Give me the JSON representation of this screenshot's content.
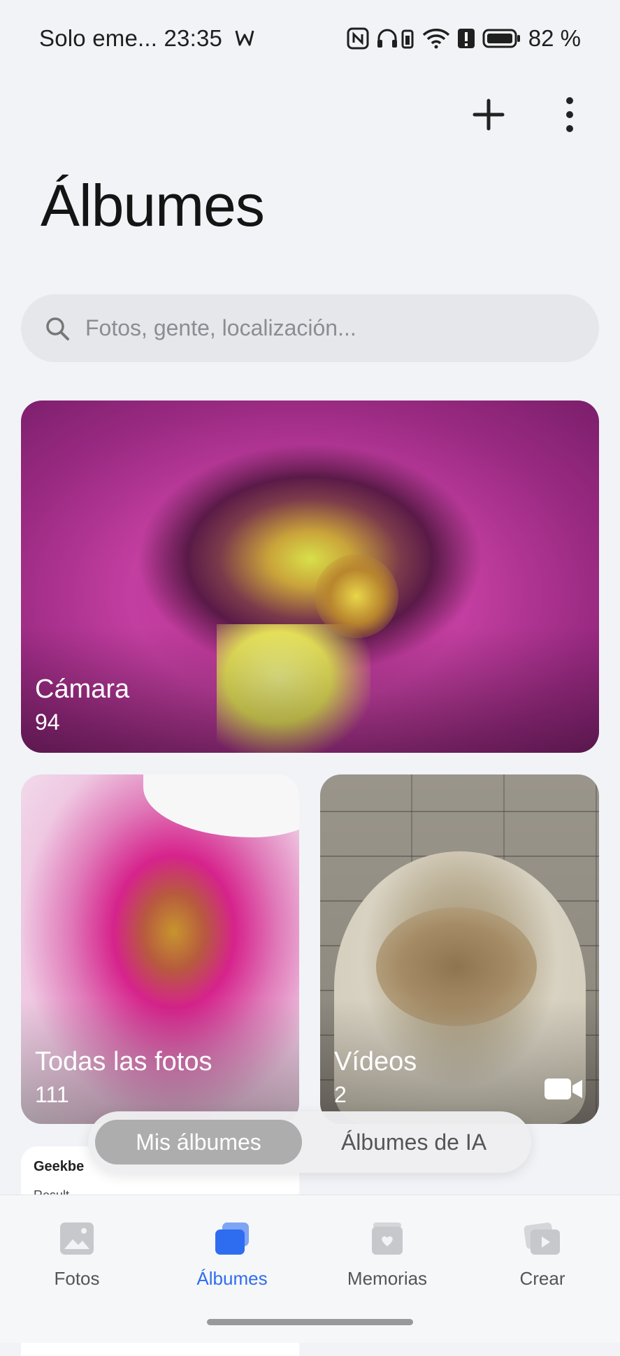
{
  "status": {
    "carrier": "Solo eme...",
    "time": "23:35",
    "battery": "82 %"
  },
  "header": {
    "title": "Álbumes"
  },
  "search": {
    "placeholder": "Fotos, gente, localización..."
  },
  "albums": [
    {
      "name": "Cámara",
      "count": "94"
    },
    {
      "name": "Todas las fotos",
      "count": "111"
    },
    {
      "name": "Vídeos",
      "count": "2"
    }
  ],
  "peek": {
    "title": "Geekbe",
    "subtitle": "Result"
  },
  "segmented": {
    "options": [
      "Mis álbumes",
      "Álbumes de IA"
    ],
    "selected": "Mis álbumes"
  },
  "bottom_nav": {
    "items": [
      "Fotos",
      "Álbumes",
      "Memorias",
      "Crear"
    ],
    "active": "Álbumes"
  },
  "colors": {
    "accent": "#2f6df0",
    "background": "#f1f3f7"
  }
}
